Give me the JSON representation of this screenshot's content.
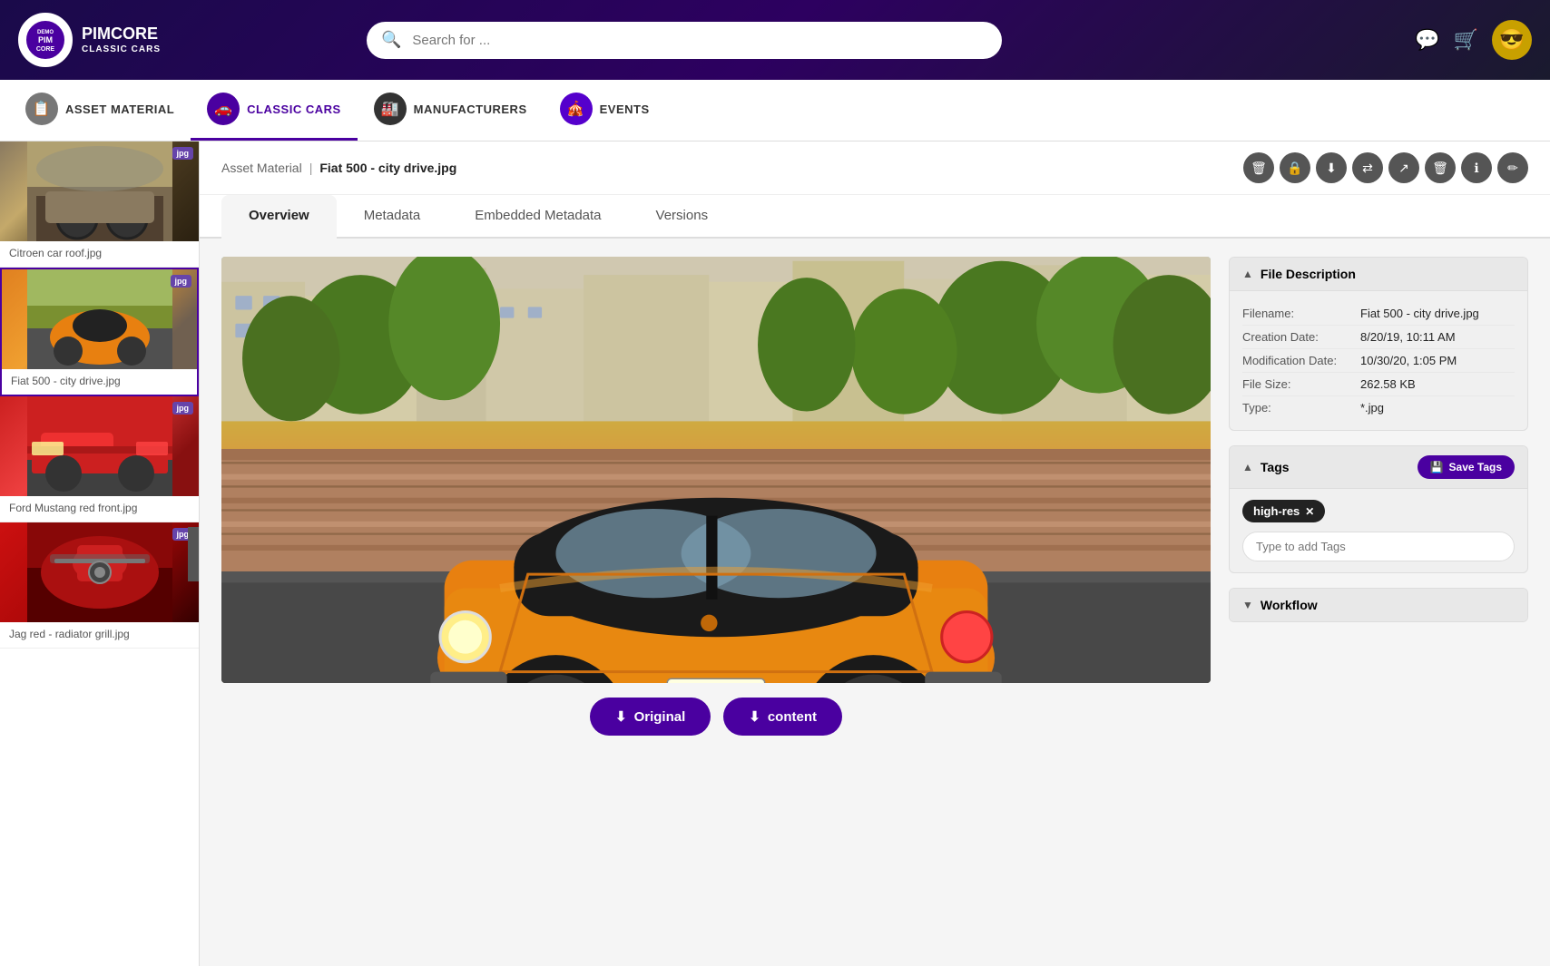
{
  "header": {
    "logo_brand": "PIMCORE",
    "logo_sub": "CLASSIC CARS",
    "search_placeholder": "Search for ...",
    "demo_badge": "DEMO"
  },
  "nav": {
    "items": [
      {
        "id": "asset-material",
        "label": "ASSET MATERIAL",
        "icon": "📋",
        "icon_style": "gray"
      },
      {
        "id": "classic-cars",
        "label": "CLASSIC CARS",
        "icon": "🚗",
        "icon_style": "purple",
        "active": true
      },
      {
        "id": "manufacturers",
        "label": "MANUFACTURERS",
        "icon": "🏭",
        "icon_style": "dark"
      },
      {
        "id": "events",
        "label": "EVENTS",
        "icon": "🎪",
        "icon_style": "violet"
      }
    ]
  },
  "sidebar": {
    "items": [
      {
        "id": "citroen",
        "label": "Citroen car roof.jpg",
        "badge": "jpg"
      },
      {
        "id": "fiat500",
        "label": "Fiat 500 - city drive.jpg",
        "badge": "jpg",
        "active": true
      },
      {
        "id": "mustang",
        "label": "Ford Mustang red front.jpg",
        "badge": "jpg"
      },
      {
        "id": "jag",
        "label": "Jag red - radiator grill.jpg",
        "badge": "jpg"
      }
    ],
    "collapse_icon": "‹"
  },
  "breadcrumb": {
    "parent": "Asset Material",
    "separator": "|",
    "current": "Fiat 500 - city drive.jpg"
  },
  "toolbar": {
    "icons": [
      {
        "id": "delete-icon",
        "symbol": "🗑"
      },
      {
        "id": "lock-icon",
        "symbol": "🔒"
      },
      {
        "id": "download-icon",
        "symbol": "⬇"
      },
      {
        "id": "transfer-icon",
        "symbol": "⇄"
      },
      {
        "id": "share-icon",
        "symbol": "↗"
      },
      {
        "id": "trash-icon",
        "symbol": "🗑"
      },
      {
        "id": "info-icon",
        "symbol": "ℹ"
      },
      {
        "id": "edit-icon",
        "symbol": "✏"
      }
    ]
  },
  "tabs": {
    "items": [
      {
        "id": "overview",
        "label": "Overview",
        "active": true
      },
      {
        "id": "metadata",
        "label": "Metadata"
      },
      {
        "id": "embedded-metadata",
        "label": "Embedded Metadata"
      },
      {
        "id": "versions",
        "label": "Versions"
      }
    ]
  },
  "file_description": {
    "section_title": "File Description",
    "rows": [
      {
        "label": "Filename:",
        "value": "Fiat 500 - city drive.jpg"
      },
      {
        "label": "Creation Date:",
        "value": "8/20/19, 10:11 AM"
      },
      {
        "label": "Modification Date:",
        "value": "10/30/20, 1:05 PM"
      },
      {
        "label": "File Size:",
        "value": "262.58 KB"
      },
      {
        "label": "Type:",
        "value": "*.jpg"
      }
    ]
  },
  "tags": {
    "section_title": "Tags",
    "save_button_label": "Save Tags",
    "existing_tags": [
      {
        "id": "high-res",
        "label": "high-res"
      }
    ],
    "input_placeholder": "Type to add Tags"
  },
  "workflow": {
    "section_title": "Workflow"
  },
  "download_buttons": [
    {
      "id": "original-btn",
      "label": "Original"
    },
    {
      "id": "content-btn",
      "label": "content"
    }
  ]
}
